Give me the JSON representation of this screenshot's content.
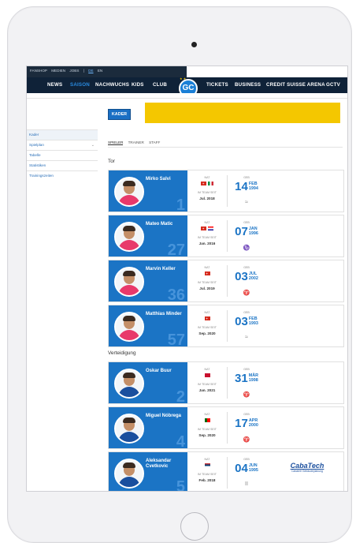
{
  "topbar": {
    "links": [
      "FANSHOP",
      "MEDIEN",
      "JOBS",
      "|",
      "DE",
      "EN"
    ],
    "social_icons": [
      "facebook-icon",
      "youtube-icon",
      "instagram-icon",
      "twitter-icon",
      "tiktok-icon"
    ]
  },
  "nav": {
    "items": [
      "NEWS",
      "SAISON",
      "NACHWUCHS",
      "KIDS",
      "CLUB",
      "TICKETS",
      "BUSINESS",
      "CREDIT SUISSE ARENA",
      "GCTV"
    ],
    "active_index": 1,
    "logo_text": "GC"
  },
  "sidebar": {
    "items": [
      "Kader",
      "Spielplan",
      "Tabelle",
      "Statistiken",
      "Trainingszeiten"
    ]
  },
  "page": {
    "title": "KADER",
    "tabs": [
      "SPIELER",
      "TRAINER",
      "STAFF"
    ],
    "active_tab": 0
  },
  "labels": {
    "nat": "NAT",
    "im_team_seit": "IM TEAM SEIT",
    "geb": "GEB"
  },
  "sections": [
    {
      "title": "Tor",
      "players": [
        {
          "name": "Mirko Salvi",
          "number": "1",
          "flags": [
            "ch",
            "it"
          ],
          "since": "Jul. 2018",
          "day": "14",
          "month": "FEB",
          "year": "1994",
          "zodiac": "≈"
        },
        {
          "name": "Mateo Matic",
          "number": "27",
          "flags": [
            "ch",
            "hr"
          ],
          "since": "Jan. 2016",
          "day": "07",
          "month": "JAN",
          "year": "1996",
          "zodiac": "♑"
        },
        {
          "name": "Marvin Keller",
          "number": "36",
          "flags": [
            "ch"
          ],
          "since": "Jul. 2019",
          "day": "03",
          "month": "JUL",
          "year": "2002",
          "zodiac": "♈"
        },
        {
          "name": "Matthias Minder",
          "number": "57",
          "flags": [
            "ch"
          ],
          "since": "Sep. 2020",
          "day": "03",
          "month": "FEB",
          "year": "1993",
          "zodiac": "≈"
        }
      ]
    },
    {
      "title": "Verteidigung",
      "players": [
        {
          "name": "Oskar Buur",
          "number": "2",
          "flags": [
            "dk"
          ],
          "since": "Jan. 2021",
          "day": "31",
          "month": "MÄR",
          "year": "1998",
          "zodiac": "♈"
        },
        {
          "name": "Miguel Nóbrega",
          "number": "4",
          "flags": [
            "pt"
          ],
          "since": "Sep. 2020",
          "day": "17",
          "month": "APR",
          "year": "2000",
          "zodiac": "♈"
        },
        {
          "name": "Aleksandar Cvetkovic",
          "number": "5",
          "flags": [
            "rs"
          ],
          "since": "Feb. 2018",
          "day": "04",
          "month": "JUN",
          "year": "1995",
          "zodiac": "II",
          "sponsor": "CabaTech",
          "sponsor_sub": "Cabaletr Gebäudeplanung"
        }
      ]
    }
  ]
}
